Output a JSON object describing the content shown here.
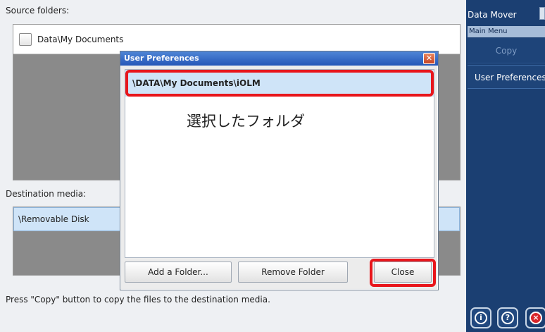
{
  "main": {
    "source_label": "Source folders:",
    "source_item": "Data\\My Documents",
    "destination_label": "Destination media:",
    "destination_item": "\\Removable Disk",
    "status": "Press \"Copy\" button to copy the files to the destination media."
  },
  "side_panel": {
    "title": "Data Mover",
    "menu_bar": "Main Menu",
    "copy_label": "Copy",
    "preferences_label": "User Preferences..."
  },
  "dialog": {
    "title": "User Preferences",
    "close_glyph": "✕",
    "selected_folder": "\\DATA\\My Documents\\iOLM",
    "annotation": "選択したフォルダ",
    "add_folder_label": "Add a Folder...",
    "remove_folder_label": "Remove Folder",
    "close_label": "Close"
  },
  "bottom_buttons": {
    "info_glyph": "i",
    "help_glyph": "?",
    "exit_glyph": "×"
  },
  "colors": {
    "side_panel": "#1b3f72",
    "highlight": "#e8161c",
    "selection": "#cfe4f8",
    "titlebar": "#2456b8"
  },
  "icons": [
    "info-icon",
    "help-icon",
    "exit-icon",
    "close-icon"
  ]
}
